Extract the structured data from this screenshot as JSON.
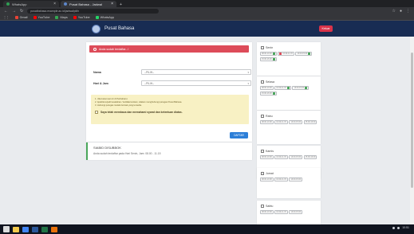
{
  "browser": {
    "tabs": [
      {
        "title": "WhatsApp",
        "active": false
      },
      {
        "title": "Pusat Bahasa - Jadwal",
        "active": true
      }
    ],
    "url": "pusatbahasa.example.ac.id/jadwal/pilih",
    "bookmarks": [
      {
        "label": "Gmail",
        "color": "#ea4335"
      },
      {
        "label": "YouTube",
        "color": "#ff0000"
      },
      {
        "label": "Maps",
        "color": "#34a853"
      },
      {
        "label": "YouTube",
        "color": "#ff0000"
      },
      {
        "label": "WhatsApp",
        "color": "#25d366"
      }
    ]
  },
  "nav": {
    "title": "Pusat Bahasa",
    "button_label": "Keluar",
    "button_color": "#d9334a"
  },
  "alert": {
    "text": "Anda sudah terdaftar...!"
  },
  "form": {
    "fields": [
      {
        "label": "Nama",
        "value": "--PILIH--"
      },
      {
        "label": "Hari & Jam",
        "value": "--PILIH--"
      }
    ],
    "note_lines": [
      "1. Jika ketemuan ini di Perbaharui.",
      "2. Apabila terjadi kesalahan / ketidakcocokan, silakan menghubungi petugas Pusat Bahasa.",
      "3. Hubungi petugas melalui kontak yang tersedia."
    ],
    "agree_label": "Saya telah membaca dan memahami syarat dan ketentuan diatas.",
    "submit_label": "DAFTAR"
  },
  "info": {
    "title": "SIABID DISUBBOK",
    "text": "Anda sudah terdaftar pada Hari Senin, Jam: 08.00 - 11.15"
  },
  "schedule": [
    {
      "day": "Senin",
      "slots": [
        {
          "t": "08.00-10.00",
          "m": "#4aa75b"
        },
        {
          "t": "10.00-11.15",
          "m": "#dd4b59"
        },
        {
          "t": "13.00-15.00",
          "m": "#4aa75b"
        },
        {
          "t": "15.00-16.00",
          "m": "#4aa75b"
        }
      ]
    },
    {
      "day": "Selasa",
      "slots": [
        {
          "t": "08.00-10.00",
          "m": ""
        },
        {
          "t": "10.00-11.15",
          "m": "#4aa75b"
        },
        {
          "t": "13.00-15.00",
          "m": "#4aa75b"
        },
        {
          "t": "15.00-16.00",
          "m": "#4aa75b"
        }
      ]
    },
    {
      "day": "Rabu",
      "slots": [
        {
          "t": "08.00-10.00",
          "m": ""
        },
        {
          "t": "10.00-11.15",
          "m": ""
        },
        {
          "t": "13.00-15.00",
          "m": ""
        },
        {
          "t": "15.00-16.00",
          "m": ""
        }
      ]
    },
    {
      "day": "Kamis",
      "slots": [
        {
          "t": "08.00-10.00",
          "m": ""
        },
        {
          "t": "10.00-11.15",
          "m": ""
        },
        {
          "t": "13.00-15.00",
          "m": ""
        },
        {
          "t": "15.00-16.00",
          "m": ""
        }
      ]
    },
    {
      "day": "Jumat",
      "slots": [
        {
          "t": "08.00-10.00",
          "m": ""
        },
        {
          "t": "10.00-11.15",
          "m": ""
        },
        {
          "t": "13.00-15.00",
          "m": ""
        }
      ]
    },
    {
      "day": "Sabtu",
      "slots": [
        {
          "t": "08.00-10.00",
          "m": ""
        },
        {
          "t": "10.00-11.15",
          "m": ""
        },
        {
          "t": "13.00-15.00",
          "m": ""
        }
      ]
    }
  ],
  "taskbar": {
    "icons": [
      {
        "name": "windows-start-icon",
        "color": "#ffffff"
      },
      {
        "name": "file-explorer-icon",
        "color": "#f2c94c"
      },
      {
        "name": "chrome-icon",
        "color": "#4285f4"
      },
      {
        "name": "word-icon",
        "color": "#2b579a"
      },
      {
        "name": "excel-icon",
        "color": "#217346"
      },
      {
        "name": "media-icon",
        "color": "#e8710a"
      }
    ],
    "clock": "10:51"
  }
}
